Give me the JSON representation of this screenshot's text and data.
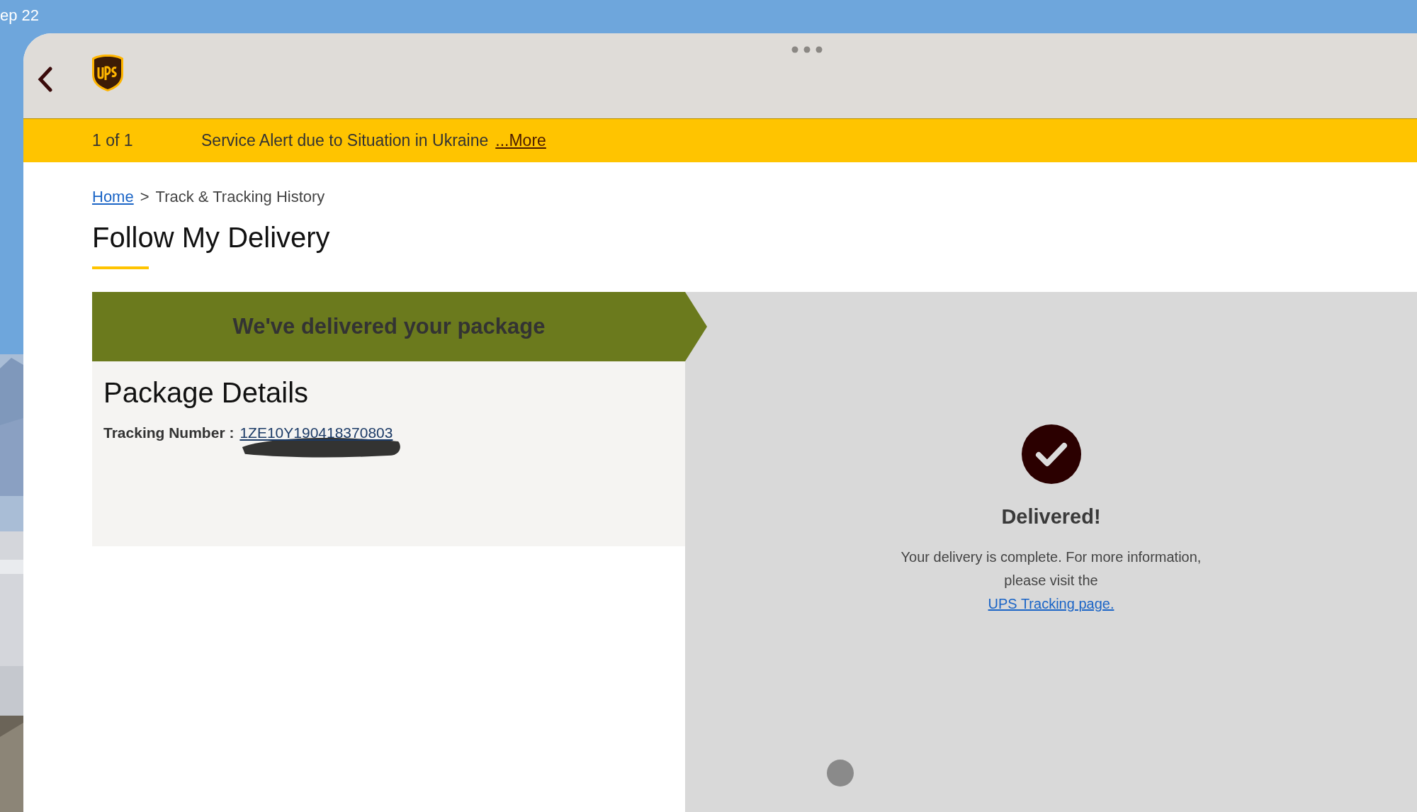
{
  "status_bar": {
    "date": "ep 22"
  },
  "alert": {
    "counter": "1 of 1",
    "message": "Service Alert due to Situation in Ukraine",
    "link": "...More"
  },
  "breadcrumb": {
    "items": [
      {
        "label": "Home",
        "kind": "link"
      },
      {
        "label": "Track & Tracking History",
        "kind": "current"
      }
    ],
    "separator": ">"
  },
  "page_title": "Follow My Delivery",
  "status_banner": "We've delivered your package",
  "package_details": {
    "title": "Package Details",
    "tracking_label": "Tracking Number :",
    "tracking_number": "1ZE10Y190418370803"
  },
  "delivery_status": {
    "title": "Delivered!",
    "message": "Your delivery is complete. For more information, please visit the",
    "link": "UPS Tracking page."
  }
}
